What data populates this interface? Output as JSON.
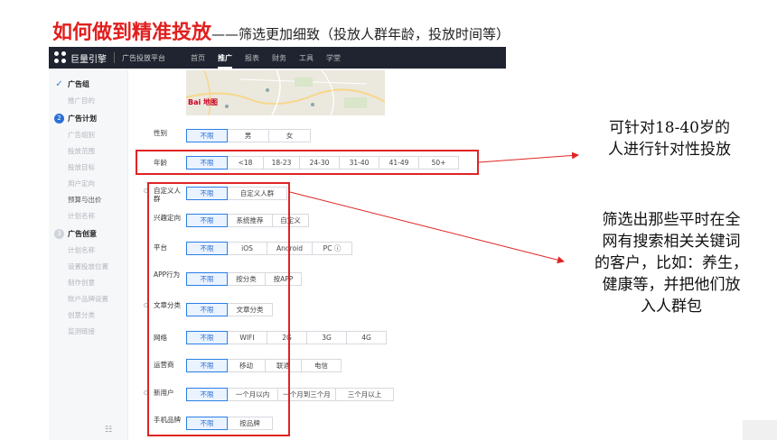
{
  "slide": {
    "title_main": "如何做到精准投放",
    "title_sub": "——筛选更加细致（投放人群年龄，投放时间等）"
  },
  "app": {
    "brand": "巨量引擎",
    "platform": "广告投放平台",
    "nav": [
      {
        "label": "首页",
        "active": false
      },
      {
        "label": "推广",
        "active": true
      },
      {
        "label": "报表",
        "active": false
      },
      {
        "label": "财务",
        "active": false
      },
      {
        "label": "工具",
        "active": false
      },
      {
        "label": "学堂",
        "active": false
      }
    ]
  },
  "sidebar": {
    "groups": [
      {
        "badge": "✓",
        "badge_state": "done",
        "title": "广告组",
        "items": [
          {
            "label": "推广目的",
            "dark": false
          }
        ]
      },
      {
        "badge": "2",
        "badge_state": "cur",
        "title": "广告计划",
        "items": [
          {
            "label": "广告组别",
            "dark": false
          },
          {
            "label": "投放范围",
            "dark": false
          },
          {
            "label": "投放目标",
            "dark": false
          },
          {
            "label": "用户定向",
            "dark": false
          },
          {
            "label": "预算与出价",
            "dark": true
          },
          {
            "label": "计划名称",
            "dark": false
          }
        ]
      },
      {
        "badge": "3",
        "badge_state": "next",
        "title": "广告创意",
        "items": [
          {
            "label": "计划名称",
            "dark": false
          },
          {
            "label": "设置投放位置",
            "dark": false
          },
          {
            "label": "制作创意",
            "dark": false
          },
          {
            "label": "账户品牌设置",
            "dark": false
          },
          {
            "label": "创意分类",
            "dark": false
          },
          {
            "label": "监测链接",
            "dark": false
          }
        ]
      }
    ],
    "collapse_icon": "grid-icon"
  },
  "map": {
    "label": "Bai 地图"
  },
  "form": {
    "rows": [
      {
        "key": "gender",
        "label": "性别",
        "options": [
          "不限",
          "男",
          "女"
        ]
      },
      {
        "key": "age",
        "label": "年龄",
        "options": [
          "不限",
          "<18",
          "18-23",
          "24-30",
          "31-40",
          "41-49",
          "50+"
        ]
      },
      {
        "key": "custom",
        "label": "自定义人群",
        "options": [
          "不限",
          "自定义人群"
        ]
      },
      {
        "key": "interest",
        "label": "兴趣定向",
        "options": [
          "不限",
          "系统推荐",
          "自定义"
        ]
      },
      {
        "key": "platform",
        "label": "平台",
        "options": [
          "不限",
          "iOS",
          "Android",
          "PC ⓘ"
        ]
      },
      {
        "key": "app",
        "label": "APP行为",
        "options": [
          "不限",
          "按分类",
          "按APP"
        ]
      },
      {
        "key": "article",
        "label": "文章分类",
        "options": [
          "不限",
          "文章分类"
        ]
      },
      {
        "key": "network",
        "label": "网络",
        "options": [
          "不限",
          "WIFI",
          "2G",
          "3G",
          "4G"
        ]
      },
      {
        "key": "carrier",
        "label": "运营商",
        "options": [
          "不限",
          "移动",
          "联通",
          "电信"
        ]
      },
      {
        "key": "newuser",
        "label": "新用户",
        "options": [
          "不限",
          "一个月以内",
          "一个月到三个月",
          "三个月以上"
        ]
      },
      {
        "key": "brand",
        "label": "手机品牌",
        "options": [
          "不限",
          "按品牌"
        ]
      }
    ]
  },
  "annotations": {
    "age_note": [
      "可针对18-40岁的",
      "人进行针对性投放"
    ],
    "filter_note": [
      "筛选出那些平时在全",
      "网有搜索相关关键词",
      "的客户，比如：养生，",
      "健康等，并把他们放",
      "入人群包"
    ]
  },
  "colors": {
    "highlight": "#e02424",
    "accent": "#2b6fd6",
    "title_red": "#e0201f"
  }
}
